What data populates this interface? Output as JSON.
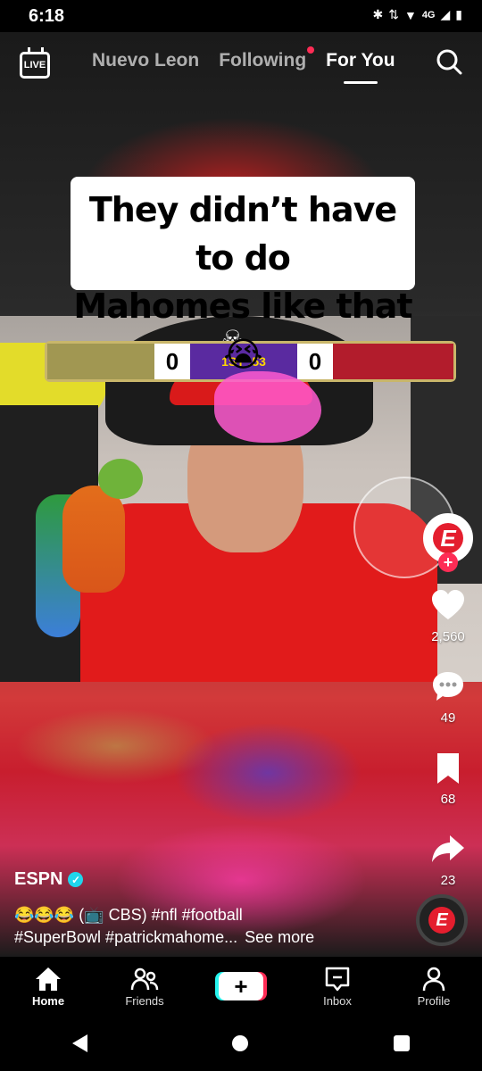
{
  "status_bar": {
    "time": "6:18",
    "network": "4G"
  },
  "top_nav": {
    "live_label": "LIVE",
    "tabs": [
      {
        "label": "Nuevo Leon",
        "active": false,
        "dot": false
      },
      {
        "label": "Following",
        "active": false,
        "dot": true
      },
      {
        "label": "For You",
        "active": true,
        "dot": false
      }
    ]
  },
  "video": {
    "caption_line1": "They didn’t have to do",
    "caption_line2": "Mahomes like that 😭",
    "scoreboard": {
      "left_score": "0",
      "middle": "1ST  :53",
      "right_score": "0"
    }
  },
  "actions": {
    "likes": "2,560",
    "comments": "49",
    "saves": "68",
    "shares": "23"
  },
  "post": {
    "author": "ESPN",
    "description_line1": "😂😂😂 (📺 CBS) #nfl #football",
    "description_line2": "#SuperBowl #patrickmahome...",
    "see_more": "See more"
  },
  "bottom_nav": {
    "home": "Home",
    "friends": "Friends",
    "create": "+",
    "inbox": "Inbox",
    "profile": "Profile"
  },
  "colors": {
    "accent_red": "#fe2c55",
    "accent_cyan": "#25f4ee",
    "verified_blue": "#20d5ec"
  }
}
